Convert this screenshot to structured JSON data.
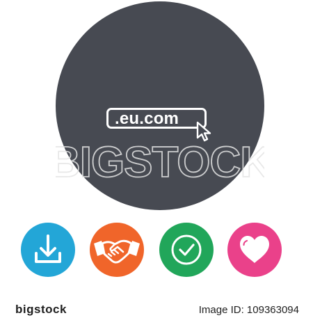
{
  "main": {
    "domain_text": ".eu.com",
    "bg_color": "#474a52",
    "watermark_text": "BIGSTOCK"
  },
  "badges": [
    {
      "name": "download",
      "icon": "download-icon",
      "color": "#23a6d7"
    },
    {
      "name": "handshake",
      "icon": "handshake-icon",
      "color": "#f0652a"
    },
    {
      "name": "check",
      "icon": "check-icon",
      "color": "#21a65a"
    },
    {
      "name": "heart",
      "icon": "heart-icon",
      "color": "#ea418a"
    }
  ],
  "footer": {
    "brand_text": "bigstock",
    "image_id_text": "Image ID: 109363094"
  }
}
